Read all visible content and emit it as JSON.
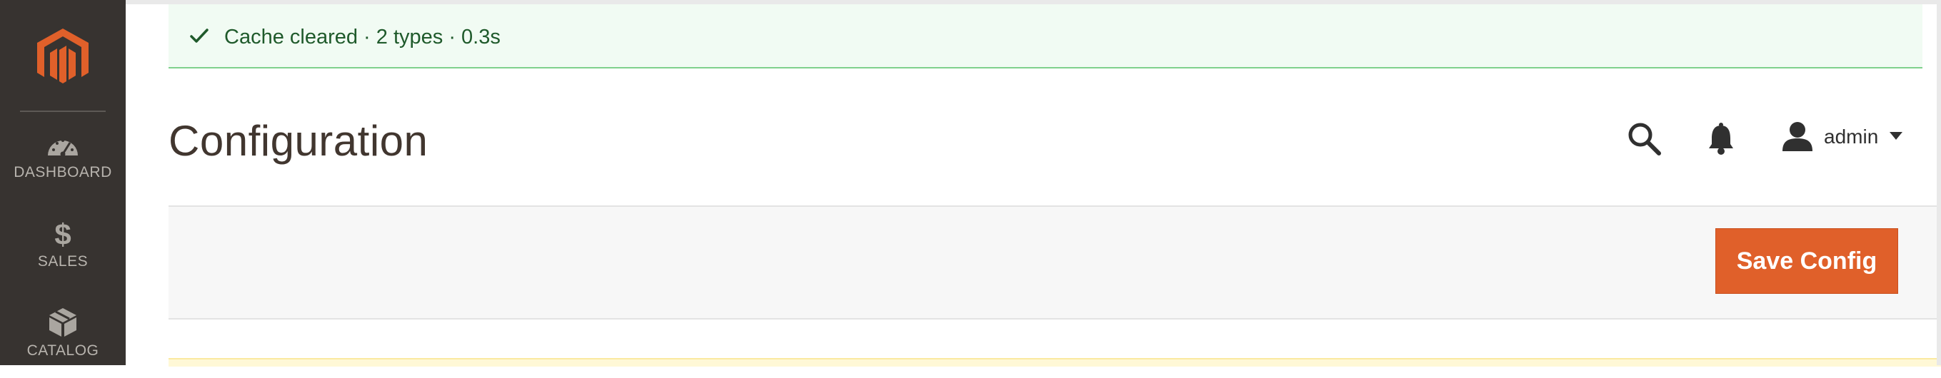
{
  "sidebar": {
    "logo_icon": "magento-logo-icon",
    "items": [
      {
        "label": "DASHBOARD",
        "icon": "speedometer-icon"
      },
      {
        "label": "SALES",
        "icon": "dollar-icon"
      },
      {
        "label": "CATALOG",
        "icon": "box-icon"
      }
    ]
  },
  "message": {
    "icon": "check-icon",
    "text": "Cache cleared · 2 types · 0.3s"
  },
  "header": {
    "title": "Configuration",
    "search_icon": "search-icon",
    "notifications_icon": "bell-icon",
    "user_name": "admin"
  },
  "actions": {
    "save_label": "Save Config"
  },
  "colors": {
    "sidebar_bg": "#373330",
    "brand_orange": "#e0602a",
    "success_bg": "#f1fbf3",
    "success_text": "#1f5a2b"
  }
}
